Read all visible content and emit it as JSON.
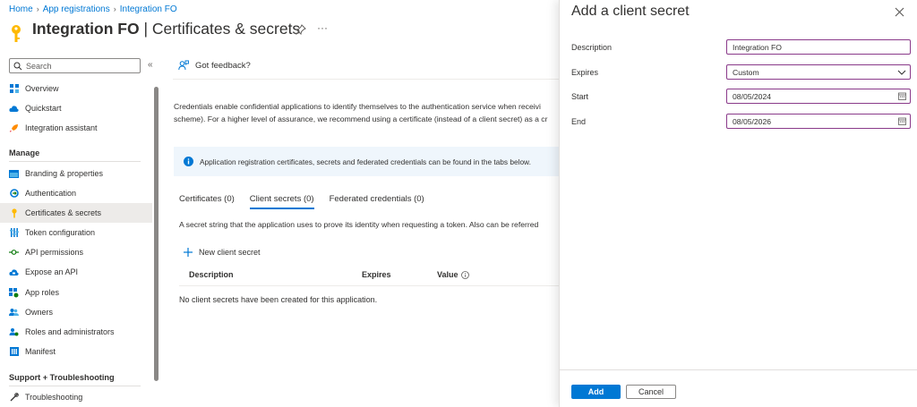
{
  "breadcrumb": [
    "Home",
    "App registrations",
    "Integration FO"
  ],
  "title": {
    "app": "Integration FO",
    "separator": " | ",
    "page": "Certificates & secrets"
  },
  "search": {
    "placeholder": "Search"
  },
  "nav_top": [
    {
      "label": "Overview",
      "icon": "overview-grid-icon"
    },
    {
      "label": "Quickstart",
      "icon": "quickstart-cloud-icon"
    },
    {
      "label": "Integration assistant",
      "icon": "rocket-icon"
    }
  ],
  "section_manage": "Manage",
  "nav_manage": [
    {
      "label": "Branding & properties",
      "icon": "branding-icon"
    },
    {
      "label": "Authentication",
      "icon": "authentication-icon"
    },
    {
      "label": "Certificates & secrets",
      "icon": "key-icon",
      "active": true
    },
    {
      "label": "Token configuration",
      "icon": "token-bars-icon"
    },
    {
      "label": "API permissions",
      "icon": "api-permissions-icon"
    },
    {
      "label": "Expose an API",
      "icon": "expose-api-cloud-icon"
    },
    {
      "label": "App roles",
      "icon": "app-roles-icon"
    },
    {
      "label": "Owners",
      "icon": "owners-icon"
    },
    {
      "label": "Roles and administrators",
      "icon": "roles-admins-icon"
    },
    {
      "label": "Manifest",
      "icon": "manifest-icon"
    }
  ],
  "section_support": "Support + Troubleshooting",
  "nav_support": [
    {
      "label": "Troubleshooting",
      "icon": "wrench-icon"
    }
  ],
  "feedback": "Got feedback?",
  "intro": {
    "line1": "Credentials enable confidential applications to identify themselves to the authentication service when receivi",
    "line2": "scheme). For a higher level of assurance, we recommend using a certificate (instead of a client secret) as a cr"
  },
  "infobar": "Application registration certificates, secrets and federated credentials can be found in the tabs below.",
  "tabs": [
    {
      "label": "Certificates (0)"
    },
    {
      "label": "Client secrets (0)",
      "active": true
    },
    {
      "label": "Federated credentials (0)"
    }
  ],
  "tab_description": "A secret string that the application uses to prove its identity when requesting a token. Also can be referred",
  "new_secret": "New client secret",
  "table": {
    "headers": [
      "Description",
      "Expires",
      "Value"
    ],
    "empty": "No client secrets have been created for this application."
  },
  "panel": {
    "title": "Add a client secret",
    "fields": [
      {
        "label": "Description",
        "value": "Integration FO"
      },
      {
        "label": "Expires",
        "value": "Custom"
      },
      {
        "label": "Start",
        "value": "08/05/2024"
      },
      {
        "label": "End",
        "value": "08/05/2026"
      }
    ],
    "add": "Add",
    "cancel": "Cancel"
  },
  "colors": {
    "accent": "#0078d4",
    "key": "#ffb900",
    "info": "#eff6fc",
    "field_border": "#8a3a8a"
  }
}
